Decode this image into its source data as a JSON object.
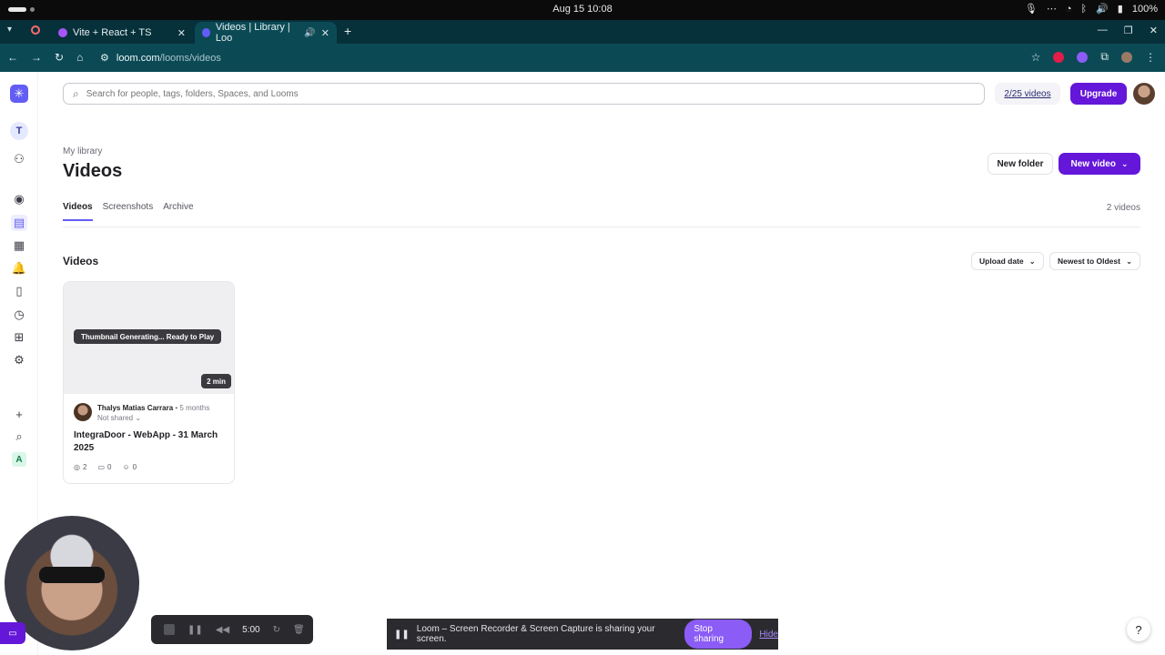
{
  "os": {
    "clock": "Aug 15  10:08",
    "battery": "100%"
  },
  "browser": {
    "tabs": [
      {
        "title": "Vite + React + TS",
        "fav_color": "#a855f7"
      },
      {
        "title": "Videos | Library | Loo",
        "fav_color": "#625df5"
      }
    ],
    "url_host": "loom.com",
    "url_path": "/looms/videos"
  },
  "header": {
    "search_placeholder": "Search for people, tags, folders, Spaces, and Looms",
    "quota": "2/25 videos",
    "upgrade": "Upgrade"
  },
  "sidebar": {
    "workspace_initial": "T",
    "bottom_initial": "A"
  },
  "page": {
    "breadcrumb": "My library",
    "title": "Videos",
    "new_folder": "New folder",
    "new_video": "New video",
    "tabs": [
      "Videos",
      "Screenshots",
      "Archive"
    ],
    "count": "2 videos",
    "section_title": "Videos",
    "sort_field": "Upload date",
    "sort_order": "Newest to Oldest"
  },
  "video": {
    "status": "Thumbnail Generating... Ready to Play",
    "duration": "2 min",
    "owner": "Thalys Matias Carrara",
    "age": "• 5 months",
    "share": "Not shared",
    "title": "IntegraDoor - WebApp - 31 March 2025",
    "views": "2",
    "comments": "0",
    "reactions": "0"
  },
  "recorder": {
    "time": "5:00"
  },
  "sharebar": {
    "message": "Loom – Screen Recorder & Screen Capture is sharing your screen.",
    "stop": "Stop sharing",
    "hide": "Hide"
  },
  "colors": {
    "brand": "#625df5",
    "primary_button": "#6417d9",
    "browser_chrome": "#0b4a55"
  }
}
